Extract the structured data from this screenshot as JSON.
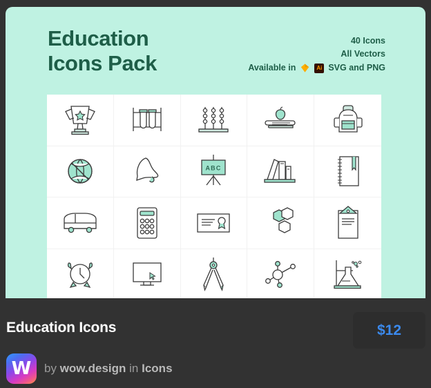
{
  "preview": {
    "background_color": "#bff2e2",
    "title_line1": "Education",
    "title_line2": "Icons Pack",
    "title_color": "#1e5e48",
    "meta": {
      "icon_count": "40 Icons",
      "vectors": "All Vectors",
      "available_in_label": "Available in",
      "formats": "SVG and PNG",
      "format_badges": [
        "sketch-diamond-icon",
        "adobe-illustrator-icon"
      ],
      "ai_badge_label": "Ai"
    }
  },
  "grid": {
    "columns": 5,
    "rows": 4,
    "accent_color": "#9fe3cd",
    "stroke_color": "#3b3b3b",
    "board_text": "ABC",
    "icons": [
      {
        "name": "trophy-icon",
        "label": "Trophy"
      },
      {
        "name": "test-tubes-icon",
        "label": "Test tubes in rack"
      },
      {
        "name": "abacus-icon",
        "label": "Abacus"
      },
      {
        "name": "apple-on-book-icon",
        "label": "Apple on book"
      },
      {
        "name": "backpack-icon",
        "label": "Backpack"
      },
      {
        "name": "basketball-icon",
        "label": "Basketball"
      },
      {
        "name": "school-bell-icon",
        "label": "School bell"
      },
      {
        "name": "abc-board-icon",
        "label": "ABC easel board"
      },
      {
        "name": "books-shelf-icon",
        "label": "Books on shelf"
      },
      {
        "name": "spiral-notebook-icon",
        "label": "Spiral notebook"
      },
      {
        "name": "school-bus-icon",
        "label": "School bus"
      },
      {
        "name": "calculator-icon",
        "label": "Calculator"
      },
      {
        "name": "certificate-icon",
        "label": "Certificate"
      },
      {
        "name": "molecule-hex-icon",
        "label": "Hexagon molecules"
      },
      {
        "name": "clipboard-icon",
        "label": "Clipboard"
      },
      {
        "name": "alarm-clock-icon",
        "label": "Alarm clock"
      },
      {
        "name": "monitor-icon",
        "label": "Computer monitor"
      },
      {
        "name": "compass-icon",
        "label": "Drawing compass"
      },
      {
        "name": "atom-bond-icon",
        "label": "Atom bonds"
      },
      {
        "name": "flask-stand-icon",
        "label": "Flask on stand"
      }
    ]
  },
  "info": {
    "product_title": "Education Icons",
    "price": "$12",
    "price_color": "#3b8aee",
    "author_prefix": "by",
    "author_name": "wow.design",
    "author_mid": "in",
    "category": "Icons",
    "avatar_letter": "W"
  }
}
